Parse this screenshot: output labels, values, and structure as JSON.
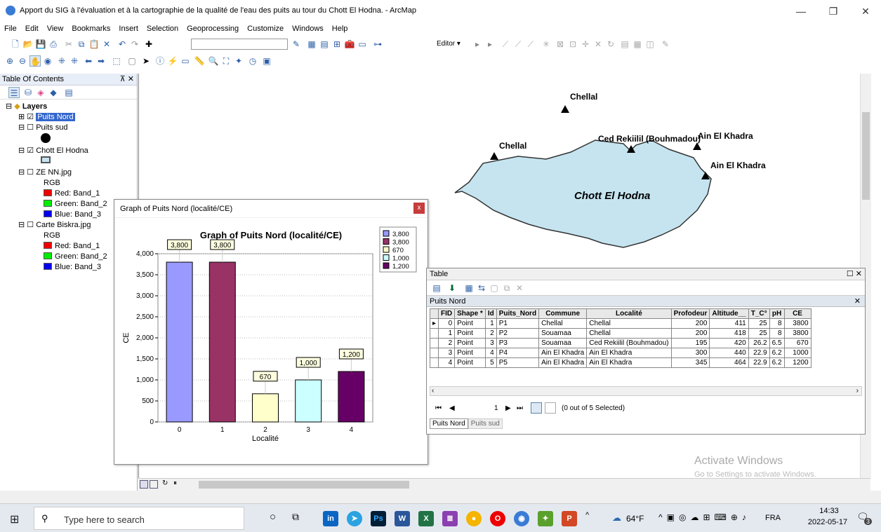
{
  "window": {
    "title": "Apport du SIG à l'évaluation et à la cartographie de la qualité de l'eau des puits au tour du Chott El Hodna. - ArcMap"
  },
  "menu": [
    "File",
    "Edit",
    "View",
    "Bookmarks",
    "Insert",
    "Selection",
    "Geoprocessing",
    "Customize",
    "Windows",
    "Help"
  ],
  "editor_label": "Editor ▾",
  "toc": {
    "title": "Table Of Contents",
    "pin": "⊼ ✕",
    "layers_label": "Layers",
    "items": [
      {
        "label": "Puits Nord",
        "checked": true,
        "selected": true
      },
      {
        "label": "Puits sud",
        "checked": false
      },
      {
        "label": "Chott El Hodna",
        "checked": true
      },
      {
        "label": "ZE NN.jpg",
        "checked": false
      },
      {
        "label": "Carte Biskra.jpg",
        "checked": false
      }
    ],
    "rgb": "RGB",
    "bands1": [
      "Red: Band_1",
      "Green: Band_2",
      "Blue: Band_3"
    ],
    "bands2": [
      "Red:  Band_1",
      "Green: Band_2",
      "Blue:  Band_3"
    ]
  },
  "map": {
    "labels": [
      "Chellal",
      "Chellal",
      "Ced Rekiilil (Bouhmadou)",
      "Ain El Khadra",
      "Ain El Khadra"
    ],
    "lake_label": "Chott El Hodna",
    "watermark_title": "Activate Windows",
    "watermark_sub": "Go to Settings to activate Windows."
  },
  "graph_window": {
    "title": "Graph of Puits Nord (localité/CE)",
    "close": "x"
  },
  "chart_data": {
    "type": "bar",
    "title": "Graph of Puits Nord (localité/CE)",
    "xlabel": "Localité",
    "ylabel": "CE",
    "categories": [
      "0",
      "1",
      "2",
      "3",
      "4"
    ],
    "values": [
      3800,
      3800,
      670,
      1000,
      1200
    ],
    "data_labels": [
      "3,800",
      "3,800",
      "670",
      "1,000",
      "1,200"
    ],
    "colors": [
      "#9999ff",
      "#993366",
      "#ffffcc",
      "#ccffff",
      "#660066"
    ],
    "ylim": [
      0,
      4000
    ],
    "yticks": [
      "0",
      "500",
      "1,000",
      "1,500",
      "2,000",
      "2,500",
      "3,000",
      "3,500",
      "4,000"
    ],
    "legend": [
      "3,800",
      "3,800",
      "670",
      "1,000",
      "1,200"
    ],
    "legend_placement": "top-right",
    "grid": true
  },
  "table_window": {
    "title": "Table",
    "tab_title": "Puits Nord",
    "columns": [
      "FID",
      "Shape *",
      "Id",
      "Puits_Nord",
      "Commune",
      "Localité",
      "Profodeur",
      "Altitude__",
      "T_C°",
      "pH",
      "CE"
    ],
    "rows": [
      [
        "0",
        "Point",
        "1",
        "P1",
        "Chellal",
        "Chellal",
        "200",
        "411",
        "25",
        "8",
        "3800"
      ],
      [
        "1",
        "Point",
        "2",
        "P2",
        "Souamaa",
        "Chellal",
        "200",
        "418",
        "25",
        "8",
        "3800"
      ],
      [
        "2",
        "Point",
        "3",
        "P3",
        "Souamaa",
        "Ced Rekiilil (Bouhmadou)",
        "195",
        "420",
        "26.2",
        "6.5",
        "670"
      ],
      [
        "3",
        "Point",
        "4",
        "P4",
        "Ain El Khadra",
        "Ain El Khadra",
        "300",
        "440",
        "22.9",
        "6.2",
        "1000"
      ],
      [
        "4",
        "Point",
        "5",
        "P5",
        "Ain El Khadra",
        "Ain El Khadra",
        "345",
        "464",
        "22.9",
        "6.2",
        "1200"
      ]
    ],
    "record": "1",
    "selection": "(0 out of 5 Selected)",
    "tabs": [
      "Puits Nord",
      "Puits sud"
    ]
  },
  "taskbar": {
    "search_placeholder": "Type here to search",
    "weather": "64°F",
    "lang": "FRA",
    "time": "14:33",
    "date": "2022-05-17",
    "notif": "3"
  }
}
